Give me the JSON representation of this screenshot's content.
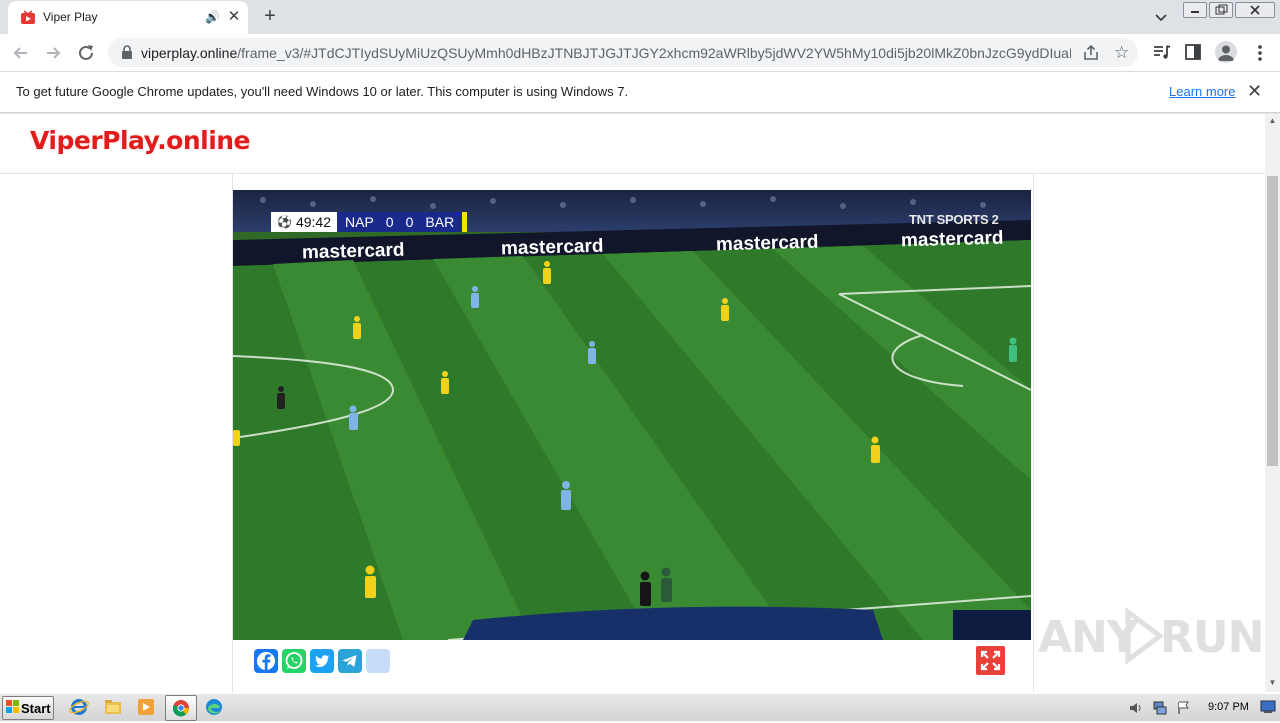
{
  "browser": {
    "tab_title": "Viper Play",
    "url_host": "viperplay.online",
    "url_path": "/frame_v3/#JTdCJTIydSUyMiUzQSUyMmh0dHBzJTNBJTJGJTJGY2xhcm92aWRlby5jdWV2YW5hMy10di5jb20lMkZ0bnJzcG9ydDIuaHR...",
    "info_message": "To get future Google Chrome updates, you'll need Windows 10 or later. This computer is using Windows 7.",
    "learn_more": "Learn more"
  },
  "site": {
    "logo_text": "ViperPlay.online",
    "logo_color": "#e21b1b"
  },
  "player": {
    "clock": "49:42",
    "home_team": "NAP",
    "home_score": "0",
    "away_score": "0",
    "away_team": "BAR",
    "broadcaster": "TNT SPORTS 2",
    "ad_text": "mastercard",
    "content": "live football match video frame"
  },
  "share": {
    "buttons": [
      "facebook-icon",
      "whatsapp-icon",
      "twitter-icon",
      "telegram-icon",
      "share-more-icon"
    ],
    "fullscreen_icon": "expand-icon"
  },
  "taskbar": {
    "start_label": "Start",
    "time": "9:07 PM",
    "apps": [
      "internet-explorer-icon",
      "file-explorer-icon",
      "media-player-icon",
      "chrome-icon",
      "edge-icon"
    ]
  },
  "watermark": {
    "left": "ANY",
    "right": "RUN"
  }
}
